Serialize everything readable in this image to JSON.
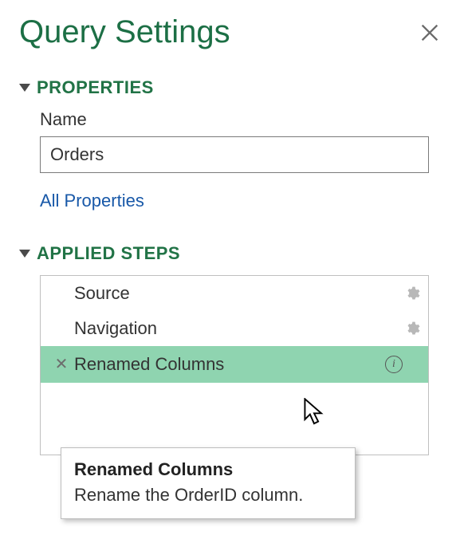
{
  "pane_title": "Query Settings",
  "sections": {
    "properties": {
      "heading": "PROPERTIES",
      "name_label": "Name",
      "name_value": "Orders",
      "all_properties_link": "All Properties"
    },
    "steps": {
      "heading": "APPLIED STEPS",
      "items": [
        {
          "label": "Source",
          "has_gear": true,
          "selected": false
        },
        {
          "label": "Navigation",
          "has_gear": true,
          "selected": false
        },
        {
          "label": "Renamed Columns",
          "has_gear": false,
          "selected": true,
          "has_info": true
        }
      ]
    }
  },
  "tooltip": {
    "title": "Renamed Columns",
    "body": "Rename the OrderID column."
  }
}
